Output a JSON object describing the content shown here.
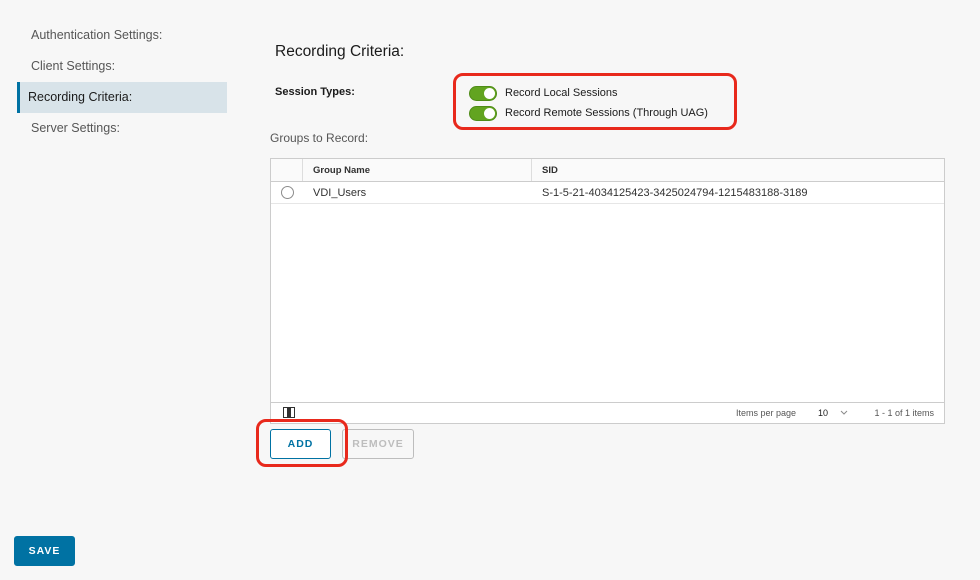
{
  "nav": {
    "items": [
      {
        "label": "Authentication Settings:"
      },
      {
        "label": "Client Settings:"
      },
      {
        "label": "Recording Criteria:",
        "active": true
      },
      {
        "label": "Server Settings:"
      }
    ]
  },
  "main": {
    "title": "Recording Criteria:",
    "session_types_label": "Session Types:",
    "toggles": [
      {
        "label": "Record Local Sessions",
        "on": true
      },
      {
        "label": "Record Remote Sessions (Through UAG)",
        "on": true
      }
    ],
    "groups_label": "Groups to Record:"
  },
  "grid": {
    "columns": [
      "Group Name",
      "SID"
    ],
    "rows": [
      {
        "group_name": "VDI_Users",
        "sid": "S-1-5-21-4034125423-3425024794-1215483188-3189"
      }
    ],
    "footer": {
      "items_per_page_label": "Items per page",
      "items_per_page_value": "10",
      "pagination": "1 - 1 of 1 items"
    }
  },
  "buttons": {
    "add": "ADD",
    "remove": "REMOVE",
    "save": "SAVE"
  },
  "colors": {
    "accent": "#0072a3",
    "toggle_on": "#62a420",
    "highlight": "#e8291c"
  }
}
